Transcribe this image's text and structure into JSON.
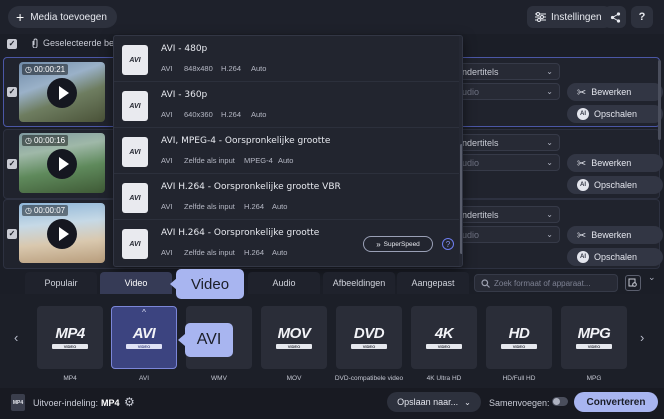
{
  "topbar": {
    "add_media": "Media toevoegen",
    "settings": "Instellingen",
    "help": "?"
  },
  "selectbar": {
    "label": "Geselecteerde be"
  },
  "files": [
    {
      "duration": "00:00:21",
      "subtitles": "ndertitels",
      "audio": "udio",
      "edit": "Bewerken",
      "upscale": "Opschalen"
    },
    {
      "duration": "00:00:16",
      "subtitles": "ndertitels",
      "audio": "udio",
      "edit": "Bewerken",
      "upscale": "Opschalen"
    },
    {
      "duration": "00:00:07",
      "subtitles": "ndertitels",
      "audio": "udio",
      "edit": "Bewerken",
      "upscale": "Opschalen"
    }
  ],
  "popup": {
    "items": [
      {
        "title": "AVI - 480p",
        "d1": "AVI",
        "d2": "848x480",
        "d3": "H.264",
        "d4": "Auto"
      },
      {
        "title": "AVI - 360p",
        "d1": "AVI",
        "d2": "640x360",
        "d3": "H.264",
        "d4": "Auto"
      },
      {
        "title": "AVI, MPEG-4 - Oorspronkelijke grootte",
        "d1": "AVI",
        "d2": "Zelfde als input",
        "d3": "MPEG-4",
        "d4": "Auto"
      },
      {
        "title": "AVI H.264 - Oorspronkelijke grootte VBR",
        "d1": "AVI",
        "d2": "Zelfde als input",
        "d3": "H.264",
        "d4": "Auto"
      },
      {
        "title": "AVI H.264 - Oorspronkelijke grootte",
        "d1": "AVI",
        "d2": "Zelfde als input",
        "d3": "H.264",
        "d4": "Auto"
      }
    ],
    "icon_label": "AVI",
    "superspeed": "SuperSpeed",
    "help": "?"
  },
  "tabs": [
    "Populair",
    "Video",
    "Audio",
    "Afbeeldingen",
    "Aangepast"
  ],
  "search_placeholder": "Zoek formaat of apparaat...",
  "callouts": {
    "video": "Video",
    "avi": "AVI"
  },
  "formats": [
    {
      "big": "MP4",
      "sub": "VIDEO",
      "label": "MP4"
    },
    {
      "big": "AVI",
      "sub": "VIDEO",
      "label": "AVI"
    },
    {
      "big": "",
      "sub": "",
      "label": "WMV"
    },
    {
      "big": "MOV",
      "sub": "VIDEO",
      "label": "MOV"
    },
    {
      "big": "DVD",
      "sub": "VIDEO",
      "label": "DVD-compatibele video"
    },
    {
      "big": "4K",
      "sub": "VIDEO",
      "label": "4K Ultra HD"
    },
    {
      "big": "HD",
      "sub": "VIDEO",
      "label": "HD/Full HD"
    },
    {
      "big": "MPG",
      "sub": "VIDEO",
      "label": "MPG"
    }
  ],
  "footer": {
    "output_label": "Uitvoer-indeling:",
    "output_value": "MP4",
    "save": "Opslaan naar...",
    "merge": "Samenvoegen:",
    "convert": "Converteren"
  },
  "colors": {
    "accent": "#a8b5f0",
    "selected_tile": "#3c4480",
    "background": "#1b1e27"
  }
}
